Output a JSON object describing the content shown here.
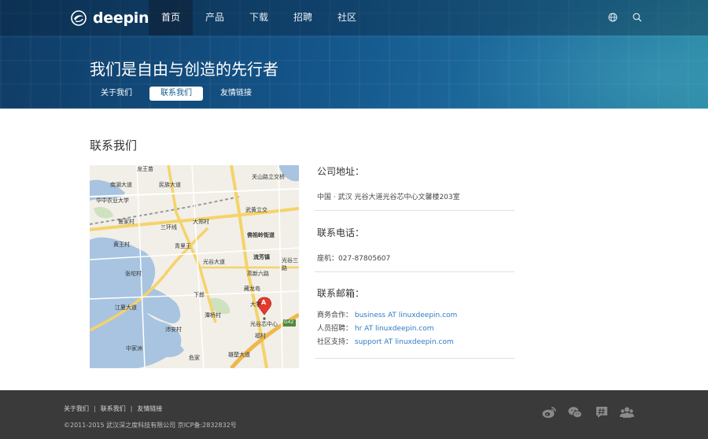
{
  "brand": {
    "name": "deepin"
  },
  "nav": {
    "items": [
      {
        "label": "首页",
        "active": true
      },
      {
        "label": "产品",
        "active": false
      },
      {
        "label": "下载",
        "active": false
      },
      {
        "label": "招聘",
        "active": false
      },
      {
        "label": "社区",
        "active": false
      }
    ],
    "icons": [
      "globe-icon",
      "search-icon"
    ]
  },
  "hero": {
    "title": "我们是自由与创造的先行者",
    "subnav": [
      {
        "label": "关于我们",
        "active": false
      },
      {
        "label": "联系我们",
        "active": true
      },
      {
        "label": "友情链接",
        "active": false
      }
    ]
  },
  "main": {
    "title": "联系我们",
    "address": {
      "heading": "公司地址：",
      "text": "中国 · 武汉 光谷大道光谷芯中心文馨楼203室"
    },
    "phone": {
      "heading": "联系电话：",
      "label": "座机：",
      "value": "027-87805607"
    },
    "email": {
      "heading": "联系邮箱：",
      "rows": [
        {
          "label": "商务合作：",
          "value": "business AT linuxdeepin.com"
        },
        {
          "label": "人员招聘：",
          "value": "hr AT linuxdeepin.com"
        },
        {
          "label": "社区支持：",
          "value": "support AT linuxdeepin.com"
        }
      ]
    },
    "map": {
      "labels": [
        "龙王苗",
        "南湖大道",
        "华中农业大学",
        "鲁家村",
        "民族大道",
        "三环线",
        "大郑村",
        "青里王",
        "佛祖岭街道",
        "黄王村",
        "张坨村",
        "光谷大道",
        "流芳镇",
        "高新六路",
        "光谷三路",
        "藏龙岛",
        "下郎",
        "光谷芯中心",
        "江夏大道",
        "中家洲",
        "潭桥村",
        "沛安村",
        "武黄立交",
        "关山路立交桥",
        "大学",
        "福村",
        "危家",
        "雄楚大道",
        "G42"
      ],
      "marker_label": "A"
    }
  },
  "footer": {
    "links": [
      "关于我们",
      "联系我们",
      "友情链接"
    ],
    "separator": "|",
    "copyright": "©2011-2015 武汉深之度科技有限公司 京ICP备:2832832号",
    "social_icons": [
      "weibo-icon",
      "wechat-icon",
      "hashtag-icon",
      "community-icon"
    ]
  },
  "colors": {
    "hero_bg": "#14558a",
    "footer_bg": "#3a3a3a",
    "link": "#2e7bc4",
    "map_water": "#a8c4e0",
    "map_road": "#f5d36a"
  }
}
